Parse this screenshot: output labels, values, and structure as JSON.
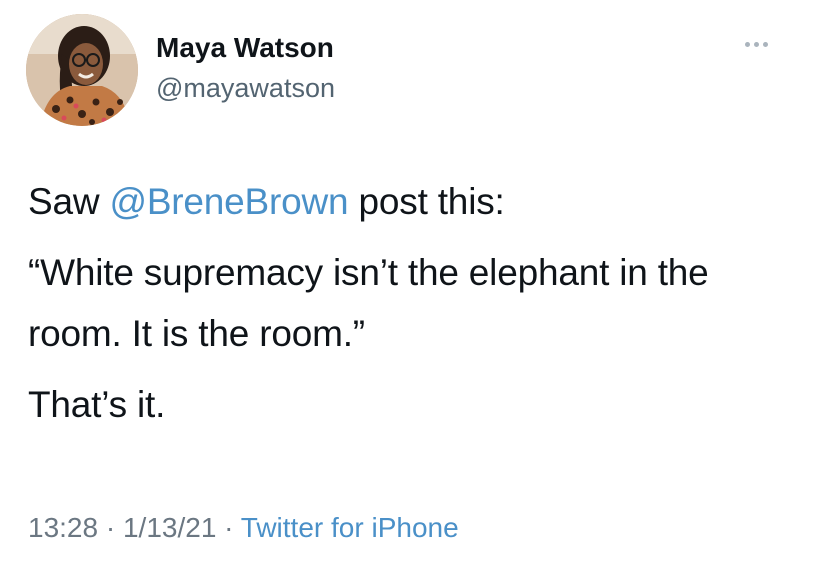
{
  "author": {
    "name": "Maya Watson",
    "handle": "@mayawatson"
  },
  "tweet": {
    "line1_prefix": "Saw ",
    "mention": "@BreneBrown",
    "line1_suffix": " post this:",
    "quote": "“White supremacy isn’t the elephant in the room. It is the room.”",
    "closing": "That’s it."
  },
  "meta": {
    "time": "13:28",
    "separator1": " · ",
    "date": "1/13/21",
    "separator2": " · ",
    "source": "Twitter for iPhone"
  },
  "icons": {
    "more": "more-horizontal-icon",
    "avatar": "profile-photo"
  },
  "colors": {
    "link": "#4a90c8",
    "secondary_text": "#6b7782",
    "text": "#0f1419"
  }
}
